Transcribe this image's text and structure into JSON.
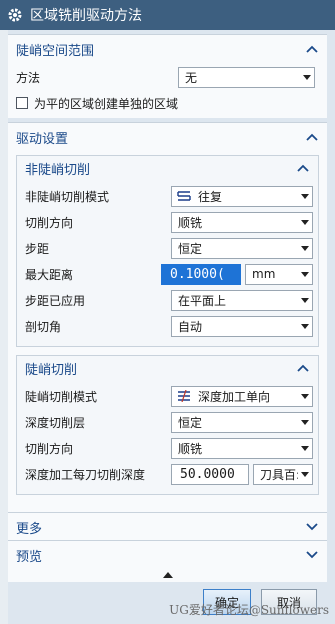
{
  "window": {
    "title": "区域铣削驱动方法"
  },
  "steep_space": {
    "title": "陡峭空间范围",
    "method_label": "方法",
    "method_value": "无",
    "checkbox_label": "为平的区域创建单独的区域"
  },
  "drive": {
    "title": "驱动设置",
    "non_steep": {
      "title": "非陡峭切削",
      "mode_label": "非陡峭切削模式",
      "mode_value": "往复",
      "mode_icon": "zigzag-icon",
      "direction_label": "切削方向",
      "direction_value": "顺铣",
      "stepover_label": "步距",
      "stepover_value": "恒定",
      "maxdist_label": "最大距离",
      "maxdist_value": "0.1000(",
      "maxdist_unit": "mm",
      "applied_label": "步距已应用",
      "applied_value": "在平面上",
      "angle_label": "剖切角",
      "angle_value": "自动"
    },
    "steep": {
      "title": "陡峭切削",
      "mode_label": "陡峭切削模式",
      "mode_value": "深度加工单向",
      "mode_icon": "depth-cut-icon",
      "layer_label": "深度切削层",
      "layer_value": "恒定",
      "direction_label": "切削方向",
      "direction_value": "顺铣",
      "depth_label": "深度加工每刀切削深度",
      "depth_value": "50.0000",
      "depth_unit": "刀具百:"
    }
  },
  "more": {
    "title": "更多"
  },
  "preview": {
    "title": "预览"
  },
  "buttons": {
    "ok": "确定",
    "cancel": "取消"
  },
  "watermark": "UG爱好者论坛@Sunflowers",
  "colors": {
    "titlebar": "#3d5f80",
    "section_title": "#1b4a8a",
    "selection": "#1e73d6"
  }
}
